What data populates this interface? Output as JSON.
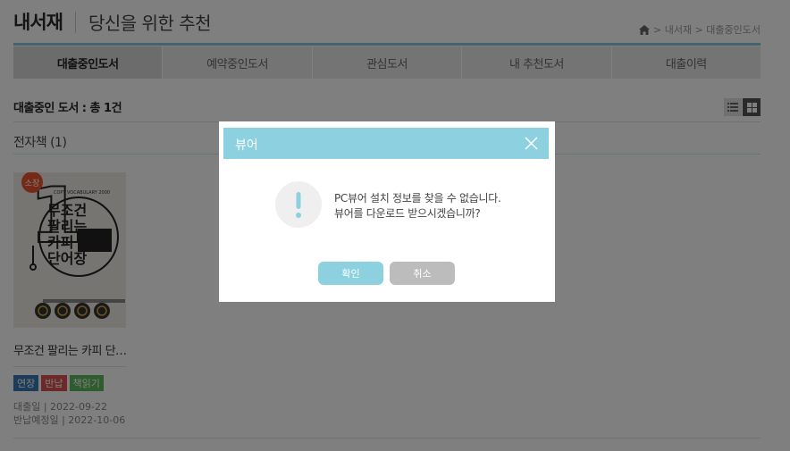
{
  "header": {
    "title": "내서재",
    "subtitle": "당신을 위한 추천",
    "breadcrumb": "> 내서재 > 대출중인도서"
  },
  "tabs": [
    {
      "label": "대출중인도서",
      "active": true
    },
    {
      "label": "예약중인도서",
      "active": false
    },
    {
      "label": "관심도서",
      "active": false
    },
    {
      "label": "내 추천도서",
      "active": false
    },
    {
      "label": "대출이력",
      "active": false
    }
  ],
  "content": {
    "count_label": "대출중인 도서 : 총 1건",
    "section_title": "전자책 (1)"
  },
  "book": {
    "badge": "소장",
    "cover_series": "COPY VOCABULARY 2000",
    "cover_title_lines": [
      "무조건",
      "팔리는",
      "카피",
      "단어장"
    ],
    "title": "무조건 팔리는 카피 단…",
    "actions": {
      "extend": "연장",
      "return": "반납",
      "read": "책읽기"
    },
    "loan_date": "대출일 | 2022-09-22",
    "due_date": "반납예정일 | 2022-10-06"
  },
  "modal": {
    "title": "뷰어",
    "message_line1": "PC뷰어 설치 정보를 찾을 수 없습니다.",
    "message_line2": "뷰어를 다운로드 받으시겠습니까?",
    "confirm": "확인",
    "cancel": "취소"
  },
  "colors": {
    "accent": "#8dd0e0",
    "extend_btn": "#3a78b5",
    "return_btn": "#d9534f",
    "read_btn": "#5cb85c",
    "cancel_btn": "#bcbcbc"
  }
}
